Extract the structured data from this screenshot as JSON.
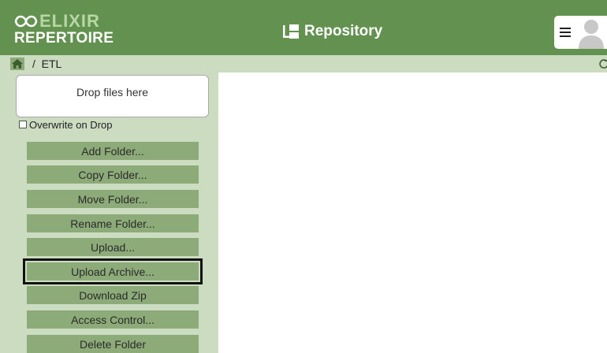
{
  "header": {
    "logo_top": "ELIXIR",
    "logo_bottom": "REPERTOIRE",
    "title": "Repository",
    "menu_icon": "hamburger-icon",
    "avatar_icon": "user-avatar-icon"
  },
  "breadcrumb": {
    "separator": "/",
    "current": "ETL"
  },
  "sidebar": {
    "dropzone": "Drop files here",
    "overwrite_label": "Overwrite on Drop",
    "overwrite_checked": false,
    "buttons": [
      "Add Folder...",
      "Copy Folder...",
      "Move Folder...",
      "Rename Folder...",
      "Upload...",
      "Upload Archive...",
      "Download Zip",
      "Access Control...",
      "Delete Folder"
    ],
    "focused_button": "Upload Archive..."
  },
  "colors": {
    "header_bg": "#639150",
    "sidebar_bg": "#cbdcc1",
    "button_bg": "#8cab78",
    "logo_accent": "#b9d7a6"
  }
}
